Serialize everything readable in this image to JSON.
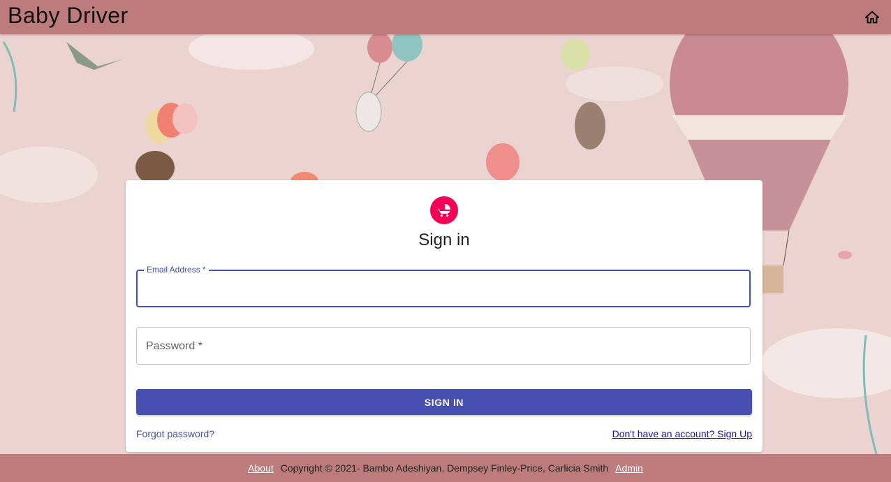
{
  "appbar": {
    "title": "Baby Driver",
    "home_icon": "home-icon"
  },
  "signin": {
    "icon": "stroller-icon",
    "heading": "Sign in",
    "email_label": "Email Address *",
    "password_label": "Password *",
    "button_label": "SIGN IN",
    "forgot_link": "Forgot password?",
    "signup_link": "Don't have an account? Sign Up"
  },
  "footer": {
    "about_link": "About",
    "copyright": "Copyright © 2021- Bambo Adeshiyan, Dempsey Finley-Price, Carlicia Smith",
    "admin_link": "Admin"
  },
  "colors": {
    "appbar": "#bd7b7b",
    "background": "#ead3d0",
    "primary": "#3f51b5",
    "button": "#4550b0",
    "avatar": "#f50057"
  }
}
